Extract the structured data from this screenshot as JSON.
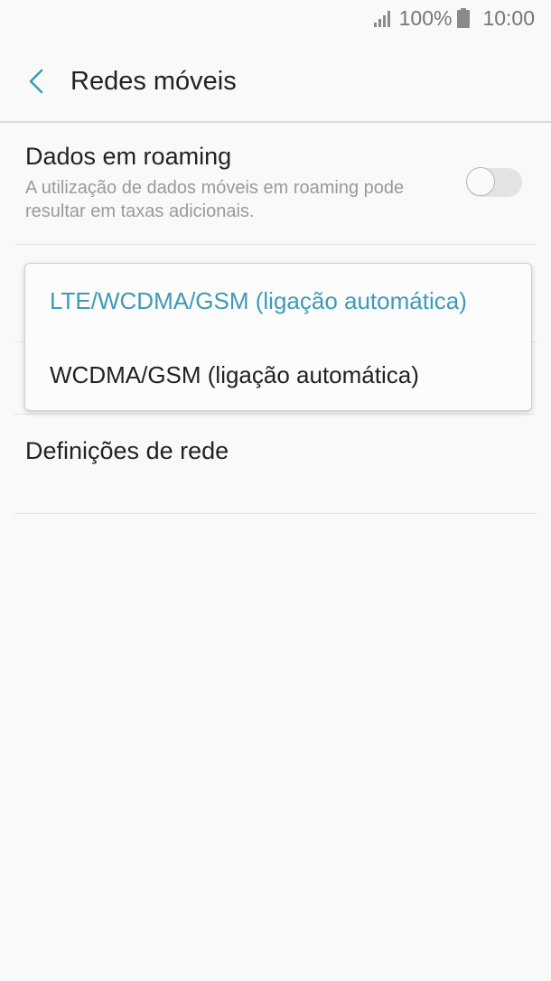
{
  "status_bar": {
    "battery_percent": "100%",
    "time": "10:00",
    "icons": [
      "signal-icon",
      "battery-icon"
    ]
  },
  "header": {
    "title": "Redes móveis",
    "back_icon": "chevron-left-icon"
  },
  "roaming": {
    "title": "Dados em roaming",
    "summary": "A utilização de dados móveis em roaming pode resultar em taxas adicionais.",
    "enabled": false
  },
  "network_settings": {
    "label": "Definições de rede"
  },
  "network_mode_menu": {
    "options": [
      {
        "label": "LTE/WCDMA/GSM (ligação automática)",
        "selected": true
      },
      {
        "label": "WCDMA/GSM (ligação automática)",
        "selected": false
      }
    ]
  },
  "colors": {
    "accent": "#3e9bb5",
    "background": "#f9f9f9"
  }
}
